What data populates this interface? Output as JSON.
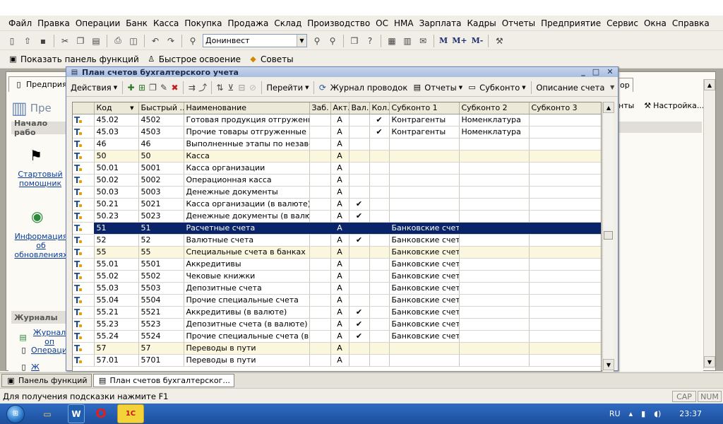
{
  "menu": [
    "Файл",
    "Правка",
    "Операции",
    "Банк",
    "Касса",
    "Покупка",
    "Продажа",
    "Склад",
    "Производство",
    "ОС",
    "НМА",
    "Зарплата",
    "Кадры",
    "Отчеты",
    "Предприятие",
    "Сервис",
    "Окна",
    "Справка"
  ],
  "toolbar": {
    "org_combo": "Донинвест",
    "m_labels": [
      "M",
      "M+",
      "M-"
    ]
  },
  "toolbar2": {
    "show_panel": "Показать панель функций",
    "quick_learn": "Быстрое освоение",
    "tips": "Советы"
  },
  "back_window": {
    "tab1": "Предприяти",
    "heading": "Пре",
    "section1": "Начало рабо",
    "link1": "Стартовый помощник",
    "link2": "Информация об обновлениях",
    "section2": "Журналы",
    "link3": "Журнал оп",
    "link4": "Операции",
    "link5": "Ж",
    "right_tab": "ор",
    "right_text1": "нты",
    "right_settings": "Настройка..."
  },
  "window": {
    "title": "План счетов бухгалтерского учета",
    "toolbar": {
      "actions": "Действия",
      "goto": "Перейти",
      "journal": "Журнал проводок",
      "reports": "Отчеты",
      "subconto": "Субконто",
      "description": "Описание счета"
    }
  },
  "table": {
    "headers": [
      "",
      "Код",
      "Быстрый ...",
      "Наименование",
      "Заб.",
      "Акт.",
      "Вал.",
      "Кол.",
      "Субконто 1",
      "Субконто 2",
      "Субконто 3"
    ],
    "rows": [
      {
        "code": "45.02",
        "fast": "4502",
        "name": "Готовая продукция отгруженная",
        "zab": "",
        "act": "А",
        "val": "",
        "kol": "✔",
        "s1": "Контрагенты",
        "s2": "Номенклатура",
        "s3": "",
        "group": false,
        "sel": false
      },
      {
        "code": "45.03",
        "fast": "4503",
        "name": "Прочие товары отгруженные",
        "zab": "",
        "act": "А",
        "val": "",
        "kol": "✔",
        "s1": "Контрагенты",
        "s2": "Номенклатура",
        "s3": "",
        "group": false,
        "sel": false
      },
      {
        "code": "46",
        "fast": "46",
        "name": "Выполненные этапы по незавер...",
        "zab": "",
        "act": "А",
        "val": "",
        "kol": "",
        "s1": "",
        "s2": "",
        "s3": "",
        "group": false,
        "sel": false
      },
      {
        "code": "50",
        "fast": "50",
        "name": "Касса",
        "zab": "",
        "act": "А",
        "val": "",
        "kol": "",
        "s1": "",
        "s2": "",
        "s3": "",
        "group": true,
        "sel": false
      },
      {
        "code": "50.01",
        "fast": "5001",
        "name": "Касса организации",
        "zab": "",
        "act": "А",
        "val": "",
        "kol": "",
        "s1": "",
        "s2": "",
        "s3": "",
        "group": false,
        "sel": false
      },
      {
        "code": "50.02",
        "fast": "5002",
        "name": "Операционная касса",
        "zab": "",
        "act": "А",
        "val": "",
        "kol": "",
        "s1": "",
        "s2": "",
        "s3": "",
        "group": false,
        "sel": false
      },
      {
        "code": "50.03",
        "fast": "5003",
        "name": "Денежные документы",
        "zab": "",
        "act": "А",
        "val": "",
        "kol": "",
        "s1": "",
        "s2": "",
        "s3": "",
        "group": false,
        "sel": false
      },
      {
        "code": "50.21",
        "fast": "5021",
        "name": "Касса организации (в валюте)",
        "zab": "",
        "act": "А",
        "val": "✔",
        "kol": "",
        "s1": "",
        "s2": "",
        "s3": "",
        "group": false,
        "sel": false
      },
      {
        "code": "50.23",
        "fast": "5023",
        "name": "Денежные документы (в валюте)",
        "zab": "",
        "act": "А",
        "val": "✔",
        "kol": "",
        "s1": "",
        "s2": "",
        "s3": "",
        "group": false,
        "sel": false
      },
      {
        "code": "51",
        "fast": "51",
        "name": "Расчетные счета",
        "zab": "",
        "act": "А",
        "val": "",
        "kol": "",
        "s1": "Банковские счета",
        "s2": "",
        "s3": "",
        "group": false,
        "sel": true
      },
      {
        "code": "52",
        "fast": "52",
        "name": "Валютные счета",
        "zab": "",
        "act": "А",
        "val": "✔",
        "kol": "",
        "s1": "Банковские счета",
        "s2": "",
        "s3": "",
        "group": false,
        "sel": false
      },
      {
        "code": "55",
        "fast": "55",
        "name": "Специальные счета в банках",
        "zab": "",
        "act": "А",
        "val": "",
        "kol": "",
        "s1": "Банковские счета",
        "s2": "",
        "s3": "",
        "group": true,
        "sel": false
      },
      {
        "code": "55.01",
        "fast": "5501",
        "name": "Аккредитивы",
        "zab": "",
        "act": "А",
        "val": "",
        "kol": "",
        "s1": "Банковские счета",
        "s2": "",
        "s3": "",
        "group": false,
        "sel": false
      },
      {
        "code": "55.02",
        "fast": "5502",
        "name": "Чековые книжки",
        "zab": "",
        "act": "А",
        "val": "",
        "kol": "",
        "s1": "Банковские счета",
        "s2": "",
        "s3": "",
        "group": false,
        "sel": false
      },
      {
        "code": "55.03",
        "fast": "5503",
        "name": "Депозитные счета",
        "zab": "",
        "act": "А",
        "val": "",
        "kol": "",
        "s1": "Банковские счета",
        "s2": "",
        "s3": "",
        "group": false,
        "sel": false
      },
      {
        "code": "55.04",
        "fast": "5504",
        "name": "Прочие специальные счета",
        "zab": "",
        "act": "А",
        "val": "",
        "kol": "",
        "s1": "Банковские счета",
        "s2": "",
        "s3": "",
        "group": false,
        "sel": false
      },
      {
        "code": "55.21",
        "fast": "5521",
        "name": "Аккредитивы (в валюте)",
        "zab": "",
        "act": "А",
        "val": "✔",
        "kol": "",
        "s1": "Банковские счета",
        "s2": "",
        "s3": "",
        "group": false,
        "sel": false
      },
      {
        "code": "55.23",
        "fast": "5523",
        "name": "Депозитные счета (в валюте)",
        "zab": "",
        "act": "А",
        "val": "✔",
        "kol": "",
        "s1": "Банковские счета",
        "s2": "",
        "s3": "",
        "group": false,
        "sel": false
      },
      {
        "code": "55.24",
        "fast": "5524",
        "name": "Прочие специальные счета (в ва...",
        "zab": "",
        "act": "А",
        "val": "✔",
        "kol": "",
        "s1": "Банковские счета",
        "s2": "",
        "s3": "",
        "group": false,
        "sel": false
      },
      {
        "code": "57",
        "fast": "57",
        "name": "Переводы в пути",
        "zab": "",
        "act": "А",
        "val": "",
        "kol": "",
        "s1": "",
        "s2": "",
        "s3": "",
        "group": true,
        "sel": false
      },
      {
        "code": "57.01",
        "fast": "5701",
        "name": "Переводы в пути",
        "zab": "",
        "act": "А",
        "val": "",
        "kol": "",
        "s1": "",
        "s2": "",
        "s3": "",
        "group": false,
        "sel": false
      }
    ]
  },
  "taskbar": {
    "item1": "Панель функций",
    "item2": "План счетов бухгалтерског..."
  },
  "status": {
    "hint": "Для получения подсказки нажмите F1",
    "cap": "CAP",
    "num": "NUM"
  },
  "system_tray": {
    "lang": "RU",
    "time": "23:37"
  },
  "colors": {
    "selection": "#0a246a",
    "group_row": "#fbf7df",
    "link": "#0a3c9a",
    "titlebar": "#a9bee0"
  }
}
